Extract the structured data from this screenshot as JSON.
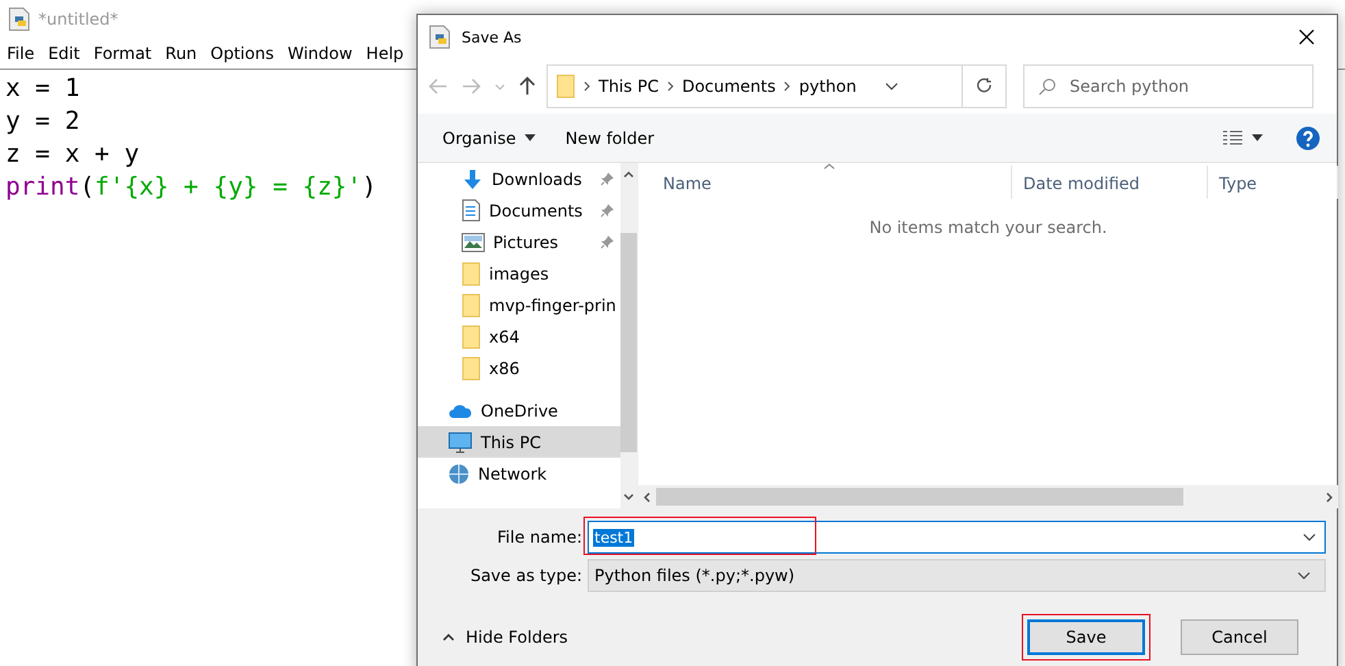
{
  "editor": {
    "title": "*untitled*",
    "menu": [
      "File",
      "Edit",
      "Format",
      "Run",
      "Options",
      "Window",
      "Help"
    ],
    "lines": [
      [
        {
          "kind": "plain",
          "text": "x = 1"
        }
      ],
      [
        {
          "kind": "plain",
          "text": "y = 2"
        }
      ],
      [
        {
          "kind": "plain",
          "text": "z = x + y"
        }
      ],
      [
        {
          "kind": "builtin",
          "text": "print"
        },
        {
          "kind": "plain",
          "text": "("
        },
        {
          "kind": "string",
          "text": "f'{x} + {y} = {z}'"
        },
        {
          "kind": "plain",
          "text": ")"
        }
      ]
    ]
  },
  "dialog": {
    "title": "Save As",
    "breadcrumbs": [
      "This PC",
      "Documents",
      "python"
    ],
    "search": {
      "placeholder": "Search python"
    },
    "toolbar": {
      "organise": "Organise",
      "new_folder": "New folder"
    },
    "nav_items": [
      {
        "kind": "downloads",
        "label": "Downloads",
        "pinned": true,
        "selected": false
      },
      {
        "kind": "documents",
        "label": "Documents",
        "pinned": true,
        "selected": false
      },
      {
        "kind": "pictures",
        "label": "Pictures",
        "pinned": true,
        "selected": false
      },
      {
        "kind": "folder",
        "label": "images",
        "pinned": false,
        "selected": false
      },
      {
        "kind": "folder",
        "label": "mvp-finger-prin",
        "pinned": false,
        "selected": false
      },
      {
        "kind": "folder",
        "label": "x64",
        "pinned": false,
        "selected": false
      },
      {
        "kind": "folder",
        "label": "x86",
        "pinned": false,
        "selected": false
      },
      {
        "kind": "cloud",
        "label": "OneDrive",
        "pinned": false,
        "selected": false
      },
      {
        "kind": "pc",
        "label": "This PC",
        "pinned": false,
        "selected": true
      },
      {
        "kind": "network",
        "label": "Network",
        "pinned": false,
        "selected": false
      }
    ],
    "columns": [
      "Name",
      "Date modified",
      "Type"
    ],
    "empty_message": "No items match your search.",
    "file_name": {
      "label": "File name:",
      "value": "test1",
      "highlighted": true
    },
    "save_as_type": {
      "label": "Save as type:",
      "value": "Python files (*.py;*.pyw)"
    },
    "hide_folders": "Hide Folders",
    "buttons": [
      {
        "label": "Save",
        "default": true,
        "highlighted": true
      },
      {
        "label": "Cancel",
        "default": false,
        "highlighted": false
      }
    ]
  }
}
